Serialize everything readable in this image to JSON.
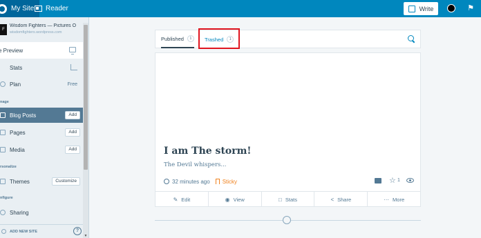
{
  "topbar": {
    "my_site": "My Site",
    "reader": "Reader",
    "write": "Write"
  },
  "sidebar": {
    "site_icon_text": "F",
    "site_title": "Wisdom Fighters — Pictures O",
    "site_url": "wisdomfighters.wordpress.com",
    "preview": "e Preview",
    "stats": "Stats",
    "plan": "Plan",
    "plan_value": "Free",
    "manage_header": "nage",
    "blog_posts": "Blog Posts",
    "blog_posts_btn": "Add",
    "pages": "Pages",
    "pages_btn": "Add",
    "media": "Media",
    "media_btn": "Add",
    "personalize_header": "rsonalize",
    "themes": "Themes",
    "themes_btn": "Customize",
    "configure_header": "nfigure",
    "sharing": "Sharing",
    "add_new_site": "ADD NEW SITE",
    "help": "?"
  },
  "tabs": {
    "published": "Published",
    "published_count": "1",
    "trashed": "Trashed",
    "trashed_count": "1"
  },
  "post": {
    "title": "I am The storm!",
    "excerpt": "The Devil whispers...",
    "time": "32 minutes ago",
    "sticky": "Sticky",
    "likes": "1"
  },
  "actions": {
    "edit": "Edit",
    "view": "View",
    "stats": "Stats",
    "share": "Share",
    "more": "More"
  },
  "colors": {
    "topbar": "#0087be",
    "active_nav": "#537994",
    "sticky": "#f0821e",
    "highlight": "#e0141e"
  }
}
